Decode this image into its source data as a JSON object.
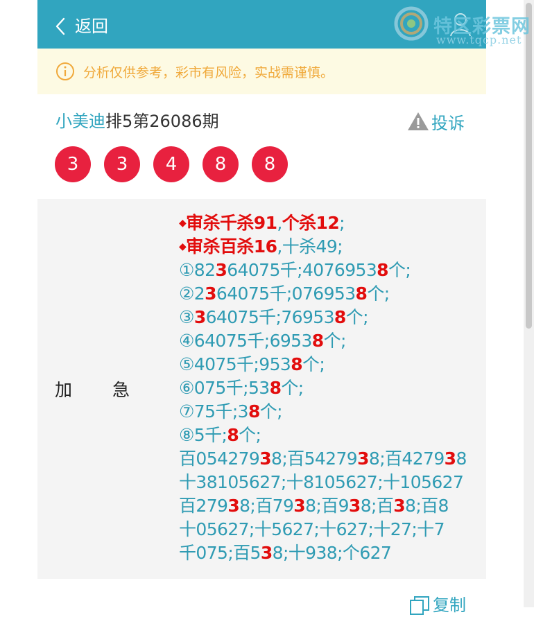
{
  "header": {
    "back_label": "返回"
  },
  "warning": {
    "text": "分析仅供参考，彩市有风险，实战需谨慎。"
  },
  "issue": {
    "author": "小美迪",
    "title_rest": "排5第26086期",
    "report_label": "投诉"
  },
  "balls": [
    "3",
    "3",
    "4",
    "8",
    "8"
  ],
  "content": {
    "row_label_1": "加",
    "row_label_2": "急",
    "lines": [
      [
        {
          "t": "◆",
          "s": "d"
        },
        {
          "t": "审杀千杀91",
          "s": "r"
        },
        {
          "t": ","
        },
        {
          "t": "个杀12",
          "s": "r"
        },
        {
          "t": ";"
        }
      ],
      [
        {
          "t": "◆",
          "s": "d"
        },
        {
          "t": "审杀百杀16",
          "s": "r"
        },
        {
          "t": ",十杀49;"
        }
      ],
      [
        {
          "t": "①82"
        },
        {
          "t": "3",
          "s": "r"
        },
        {
          "t": "64075千;4076953"
        },
        {
          "t": "8",
          "s": "r"
        },
        {
          "t": "个;"
        }
      ],
      [
        {
          "t": "②2"
        },
        {
          "t": "3",
          "s": "r"
        },
        {
          "t": "64075千;076953"
        },
        {
          "t": "8",
          "s": "r"
        },
        {
          "t": "个;"
        }
      ],
      [
        {
          "t": "③"
        },
        {
          "t": "3",
          "s": "r"
        },
        {
          "t": "64075千;76953"
        },
        {
          "t": "8",
          "s": "r"
        },
        {
          "t": "个;"
        }
      ],
      [
        {
          "t": "④64075千;6953"
        },
        {
          "t": "8",
          "s": "r"
        },
        {
          "t": "个;"
        }
      ],
      [
        {
          "t": "⑤4075千;953"
        },
        {
          "t": "8",
          "s": "r"
        },
        {
          "t": "个;"
        }
      ],
      [
        {
          "t": "⑥075千;53"
        },
        {
          "t": "8",
          "s": "r"
        },
        {
          "t": "个;"
        }
      ],
      [
        {
          "t": "⑦75千;3"
        },
        {
          "t": "8",
          "s": "r"
        },
        {
          "t": "个;"
        }
      ],
      [
        {
          "t": "⑧5千;"
        },
        {
          "t": "8",
          "s": "r"
        },
        {
          "t": "个;"
        }
      ],
      [
        {
          "t": "百054279"
        },
        {
          "t": "3",
          "s": "r"
        },
        {
          "t": "8;百54279"
        },
        {
          "t": "3",
          "s": "r"
        },
        {
          "t": "8;百4279"
        },
        {
          "t": "3",
          "s": "r"
        },
        {
          "t": "8"
        }
      ],
      [
        {
          "t": "十38105627;十8105627;十105627"
        }
      ],
      [
        {
          "t": "百279"
        },
        {
          "t": "3",
          "s": "r"
        },
        {
          "t": "8;百79"
        },
        {
          "t": "3",
          "s": "r"
        },
        {
          "t": "8;百9"
        },
        {
          "t": "3",
          "s": "r"
        },
        {
          "t": "8;百"
        },
        {
          "t": "3",
          "s": "r"
        },
        {
          "t": "8;百8"
        }
      ],
      [
        {
          "t": "十05627;十5627;十627;十27;十7"
        }
      ],
      [
        {
          "t": "千075;百5"
        },
        {
          "t": "3",
          "s": "r"
        },
        {
          "t": "8;十938;个627"
        }
      ]
    ]
  },
  "copy": {
    "label": "复制"
  },
  "watermark": {
    "title": "特区彩票网",
    "url": "www.tqcp.net"
  },
  "colors": {
    "header": "#31a5bf",
    "ball": "#e8213f",
    "highlight": "#e20d0d",
    "warning_text": "#f0a93b"
  }
}
